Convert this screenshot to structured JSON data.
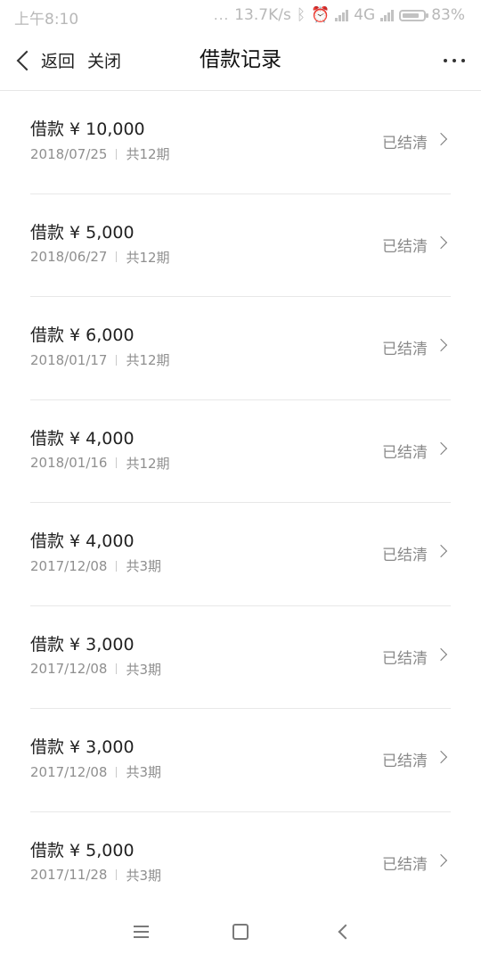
{
  "status_bar": {
    "time": "上午8:10",
    "dots": "...",
    "network_speed": "13.7K/s",
    "network_type": "4G",
    "battery_percent": "83%",
    "battery_level": 0.83
  },
  "nav": {
    "back_label": "返回",
    "close_label": "关闭",
    "title": "借款记录"
  },
  "loans": [
    {
      "amount": "借款 ¥ 10,000",
      "date": "2018/07/25",
      "term": "共12期",
      "status": "已结清"
    },
    {
      "amount": "借款 ¥ 5,000",
      "date": "2018/06/27",
      "term": "共12期",
      "status": "已结清"
    },
    {
      "amount": "借款 ¥ 6,000",
      "date": "2018/01/17",
      "term": "共12期",
      "status": "已结清"
    },
    {
      "amount": "借款 ¥ 4,000",
      "date": "2018/01/16",
      "term": "共12期",
      "status": "已结清"
    },
    {
      "amount": "借款 ¥ 4,000",
      "date": "2017/12/08",
      "term": "共3期",
      "status": "已结清"
    },
    {
      "amount": "借款 ¥ 3,000",
      "date": "2017/12/08",
      "term": "共3期",
      "status": "已结清"
    },
    {
      "amount": "借款 ¥ 3,000",
      "date": "2017/12/08",
      "term": "共3期",
      "status": "已结清"
    },
    {
      "amount": "借款 ¥ 5,000",
      "date": "2017/11/28",
      "term": "共3期",
      "status": "已结清"
    }
  ],
  "icons": {
    "back": "chevron-left-icon",
    "more": "more-dots-icon",
    "row": "chevron-right-icon",
    "system_menu": "menu-icon",
    "system_home": "home-square-icon",
    "system_back": "back-triangle-icon"
  }
}
